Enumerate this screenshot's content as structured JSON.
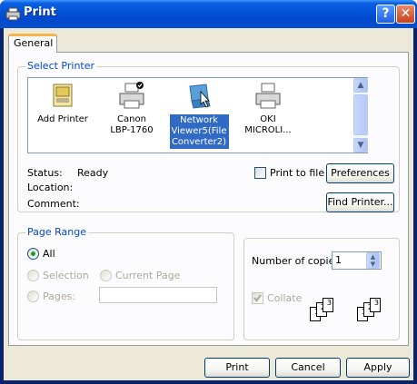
{
  "window": {
    "title": "Print",
    "help_button": "?",
    "close_button": "✕"
  },
  "tabs": [
    {
      "label": "General"
    }
  ],
  "select_printer": {
    "legend": "Select Printer",
    "printers": [
      {
        "name": "Add Printer",
        "icon": "add-printer-icon"
      },
      {
        "name": "Canon LBP-1760",
        "line1": "Canon",
        "line2": "LBP-1760",
        "icon": "printer-icon"
      },
      {
        "name": "Network Viewer5(File Converter2)",
        "line1": "Network",
        "line2": "Viewer5(File",
        "line3": "Converter2)",
        "icon": "network-printer-icon",
        "selected": true
      },
      {
        "name": "OKI MICROLI...",
        "line1": "OKI",
        "line2": "MICROLI...",
        "icon": "printer-icon"
      }
    ],
    "status_label": "Status:",
    "status_value": "Ready",
    "location_label": "Location:",
    "location_value": "",
    "comment_label": "Comment:",
    "comment_value": "",
    "print_to_file_label": "Print to file",
    "print_to_file_checked": false,
    "preferences_button": "Preferences",
    "find_printer_button": "Find Printer..."
  },
  "page_range": {
    "legend": "Page Range",
    "all_label": "All",
    "selection_label": "Selection",
    "current_page_label": "Current Page",
    "pages_label": "Pages:",
    "pages_value": "",
    "selected_option": "All"
  },
  "copies": {
    "number_label": "Number of copies:",
    "number_value": "1",
    "collate_label": "Collate",
    "collate_checked": true
  },
  "buttons": {
    "print": "Print",
    "cancel": "Cancel",
    "apply": "Apply"
  },
  "colors": {
    "titlebar": "#0553d8",
    "selection": "#316ac5",
    "legend": "#0046d5",
    "dialog_bg": "#ece9d8"
  }
}
